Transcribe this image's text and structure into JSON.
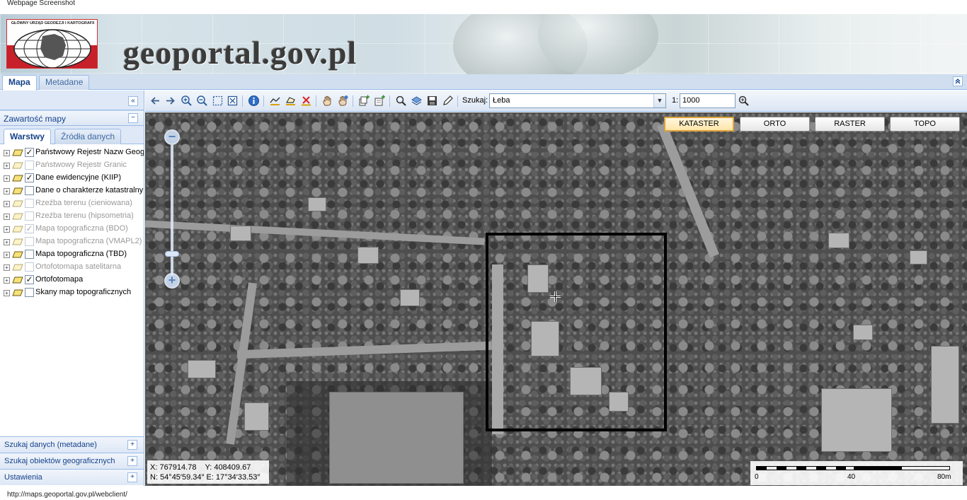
{
  "window": {
    "title": "Webpage Screenshot"
  },
  "banner": {
    "logo_text": "GŁÓWNY URZĄD GEODEZJI I KARTOGRAFII",
    "site_title": "geoportal.gov.pl"
  },
  "main_tabs": [
    {
      "label": "Mapa",
      "active": true
    },
    {
      "label": "Metadane",
      "active": false
    }
  ],
  "left_panel": {
    "collapse_symbol": "«",
    "section_title": "Zawartość mapy",
    "section_toggle": "−",
    "sub_tabs": [
      {
        "label": "Warstwy",
        "active": true
      },
      {
        "label": "Źródła danych",
        "active": false
      }
    ],
    "layers": [
      {
        "label": "Państwowy Rejestr Nazw Geograficznych",
        "checked": true,
        "enabled": true
      },
      {
        "label": "Państwowy Rejestr Granic",
        "checked": false,
        "enabled": false
      },
      {
        "label": "Dane ewidencyjne (KIIP)",
        "checked": true,
        "enabled": true
      },
      {
        "label": "Dane o charakterze katastralnym",
        "checked": false,
        "enabled": true
      },
      {
        "label": "Rzeźba terenu (cieniowana)",
        "checked": false,
        "enabled": false
      },
      {
        "label": "Rzeźba terenu (hipsometria)",
        "checked": false,
        "enabled": false
      },
      {
        "label": "Mapa topograficzna (BDO)",
        "checked": true,
        "enabled": false
      },
      {
        "label": "Mapa topograficzna (VMAPL2)",
        "checked": false,
        "enabled": false
      },
      {
        "label": "Mapa topograficzna (TBD)",
        "checked": false,
        "enabled": true
      },
      {
        "label": "Ortofotomapa satelitarna",
        "checked": false,
        "enabled": false
      },
      {
        "label": "Ortofotomapa",
        "checked": true,
        "enabled": true
      },
      {
        "label": "Skany map topograficznych",
        "checked": false,
        "enabled": true
      }
    ],
    "accordion": [
      {
        "label": "Szukaj danych (metadane)",
        "toggle": "+"
      },
      {
        "label": "Szukaj obiektów geograficznych",
        "toggle": "+"
      },
      {
        "label": "Ustawienia",
        "toggle": "+"
      }
    ]
  },
  "toolbar": {
    "icons": [
      "arrow-left-icon",
      "arrow-right-icon",
      "zoom-in-icon",
      "zoom-out-icon",
      "zoom-box-icon",
      "zoom-extent-icon",
      "info-icon",
      "measure-line-icon",
      "measure-area-icon",
      "clear-measure-icon",
      "pan-hand-icon",
      "pan-hand-alt-icon",
      "add-layer-icon",
      "add-service-icon",
      "search-icon",
      "layers-icon",
      "save-icon",
      "edit-icon"
    ],
    "search_label": "Szukaj:",
    "search_value": "Łeba",
    "dropdown_symbol": "▼",
    "scale_prefix": "1:",
    "scale_value": "1000"
  },
  "map": {
    "base_layers": [
      {
        "label": "KATASTER",
        "active": true
      },
      {
        "label": "ORTO",
        "active": false
      },
      {
        "label": "RASTER",
        "active": false
      },
      {
        "label": "TOPO",
        "active": false
      }
    ],
    "zoom_out_symbol": "−",
    "zoom_in_symbol": "+",
    "zoom_level_fraction": 0.15,
    "coords": {
      "x_label": "X: 767914.78",
      "y_label": "Y: 408409.67",
      "n_label": "N: 54°45′59.34″",
      "e_label": "E: 17°34′33.53″"
    },
    "scale_ticks": [
      "0",
      "40",
      "80m"
    ]
  },
  "status_url": "http://maps.geoportal.gov.pl/webclient/",
  "colors": {
    "accent": "#15428b",
    "panel_border": "#99bbe8",
    "active_base": "#d9a33d",
    "logo_red": "#c8202a"
  }
}
